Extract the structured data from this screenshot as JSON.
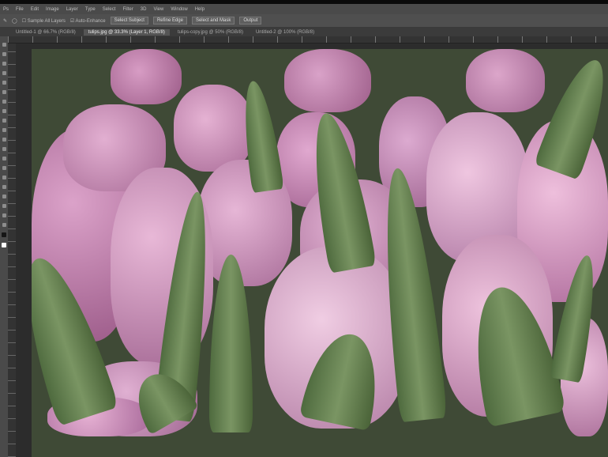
{
  "menubar": {
    "items": [
      "Ps",
      "File",
      "Edit",
      "Image",
      "Layer",
      "Type",
      "Select",
      "Filter",
      "3D",
      "View",
      "Window",
      "Help"
    ]
  },
  "options": {
    "tool": "quick-selection-tool",
    "sample_all_layers": "Sample All Layers",
    "auto_enhance": "Auto-Enhance",
    "refine_edge": "Refine Edge",
    "buttons": [
      "Select Subject",
      "Refine Edge",
      "Select and Mask",
      "Output"
    ]
  },
  "tabs": [
    {
      "label": "Untitled-1 @ 66.7% (RGB/8)"
    },
    {
      "label": "tulips.jpg @ 33.3% (Layer 1, RGB/8)",
      "active": true
    },
    {
      "label": "tulips-copy.jpg @ 50% (RGB/8)"
    },
    {
      "label": "Untitled-2 @ 100% (RGB/8)"
    }
  ],
  "canvas": {
    "image": "pink tulips photo"
  }
}
